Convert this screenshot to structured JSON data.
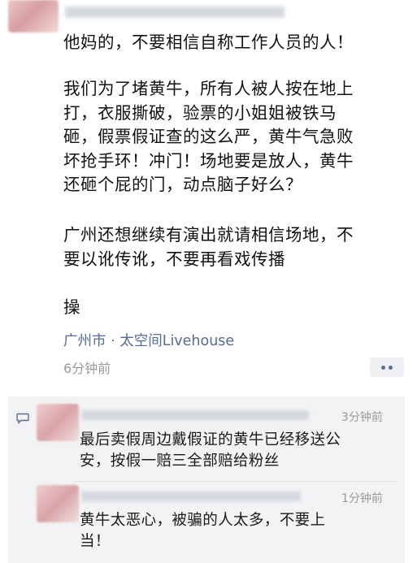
{
  "post": {
    "text_line1": "他妈的，不要相信自称工作人员的人！",
    "paragraph2": "我们为了堵黄牛，所有人被人按在地上\n打，衣服撕破，验票的小姐姐被铁马\n砸，假票假证查的这么严，黄牛气急败\n坏抢手环！冲门！场地要是放人，黄牛\n还砸个屁的门，动点脑子好么？",
    "paragraph3": "广州还想继续有演出就请相信场地，不\n要以讹传讹，不要再看戏传播",
    "paragraph4": "操",
    "location": "广州市 · 太空间Livehouse",
    "time": "6分钟前"
  },
  "comments": [
    {
      "time": "3分钟前",
      "text": "最后卖假周边戴假证的黄牛已经移送公\n安，按假一赔三全部赔给粉丝"
    },
    {
      "time": "1分钟前",
      "text": "黄牛太恶心，被骗的人太多，不要上\n当！"
    }
  ],
  "icons": {
    "comment": "comment-icon",
    "more": "more-icon"
  },
  "colors": {
    "link": "#576b95",
    "meta": "#9a9a9a",
    "comment_bg": "#f3f3f5"
  }
}
